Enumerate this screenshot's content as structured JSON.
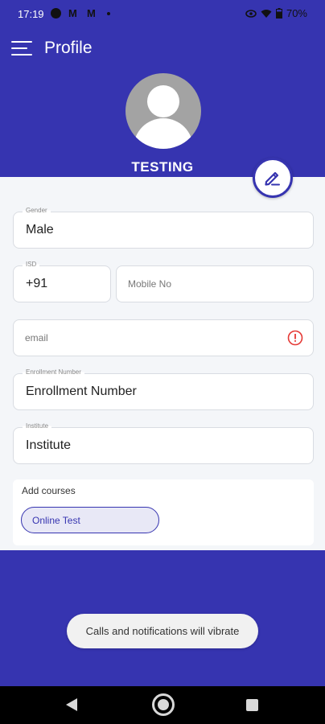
{
  "status_bar": {
    "time": "17:19",
    "notification_glyph_1": "M",
    "notification_glyph_2": "M",
    "battery_percent": "70%"
  },
  "header": {
    "title": "Profile",
    "menu_icon": "hamburger-menu-icon",
    "user_name": "TESTING"
  },
  "form": {
    "gender": {
      "label": "Gender",
      "value": "Male"
    },
    "isd": {
      "label": "ISD",
      "value": "+91"
    },
    "mobile": {
      "placeholder": "Mobile No"
    },
    "email": {
      "placeholder": "email",
      "error_icon": "error-circle-icon"
    },
    "enrollment": {
      "label": "Enrollment Number",
      "value": "Enrollment Number"
    },
    "institute": {
      "label": "Institute",
      "value": "Institute"
    }
  },
  "courses": {
    "title": "Add courses",
    "items": [
      "Online Test"
    ]
  },
  "toast": {
    "message": "Calls and notifications will vibrate"
  },
  "colors": {
    "primary": "#3634b0",
    "background": "#f4f6f9",
    "error": "#e53935",
    "chip_bg": "#e8e8f6"
  }
}
